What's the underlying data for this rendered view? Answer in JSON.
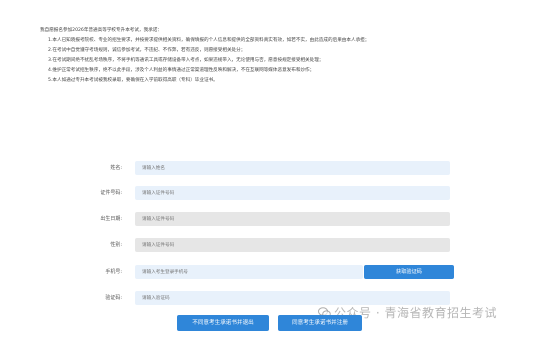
{
  "intro": {
    "lead": "我自愿报名参加2026年普通高等学校专升本考试，我承诺：",
    "items": [
      "1.本人已知晓报考院校、专业的招生要求，并按要求提供相关资料，确保填报的个人信息和提供的全部资料真实有效，如若不实，由此造成的后果由本人承担；",
      "2.在考试中自觉遵守考场规则，诚信参加考试，不违纪、不作弊，若有违反，则愿接受相关处分；",
      "3.在考试期间绝不扰乱考场秩序，不将手机等通讯工具或存储设备带入考点，如果违规带入，无论使用与否，愿意按规定接受相关处理；",
      "4.维护正常考试招生秩序，绝不以此手段，涉及个人利益的事情通过正常渠道理性反映和解决，不在互联网等媒体恶意发布和炒作；",
      "5.本人如通过专升本考试被我校录取，要确保在入学前取得高职（专科）毕业证书。"
    ]
  },
  "form": {
    "name": {
      "label": "姓名:",
      "placeholder": "请输入姓名"
    },
    "id_number": {
      "label": "证件号码:",
      "placeholder": "请输入证件号码"
    },
    "birth_date": {
      "label": "出生日期:",
      "placeholder": "请输入证件号码"
    },
    "gender": {
      "label": "性别:",
      "placeholder": "请输入证件号码"
    },
    "phone": {
      "label": "手机号:",
      "placeholder": "请输入考生登录手机号"
    },
    "sms_button": "获取验证码",
    "code": {
      "label": "验证码:",
      "placeholder": "请输入验证码"
    }
  },
  "buttons": {
    "decline": "不同意考生承诺书并退出",
    "accept": "同意考生承诺书并注册"
  },
  "watermark": "公众号 · 青海省教育招生考试",
  "colors": {
    "primary": "#2f86d9",
    "input_blue": "#e8f1fb",
    "input_gray": "#e6e6e6"
  }
}
